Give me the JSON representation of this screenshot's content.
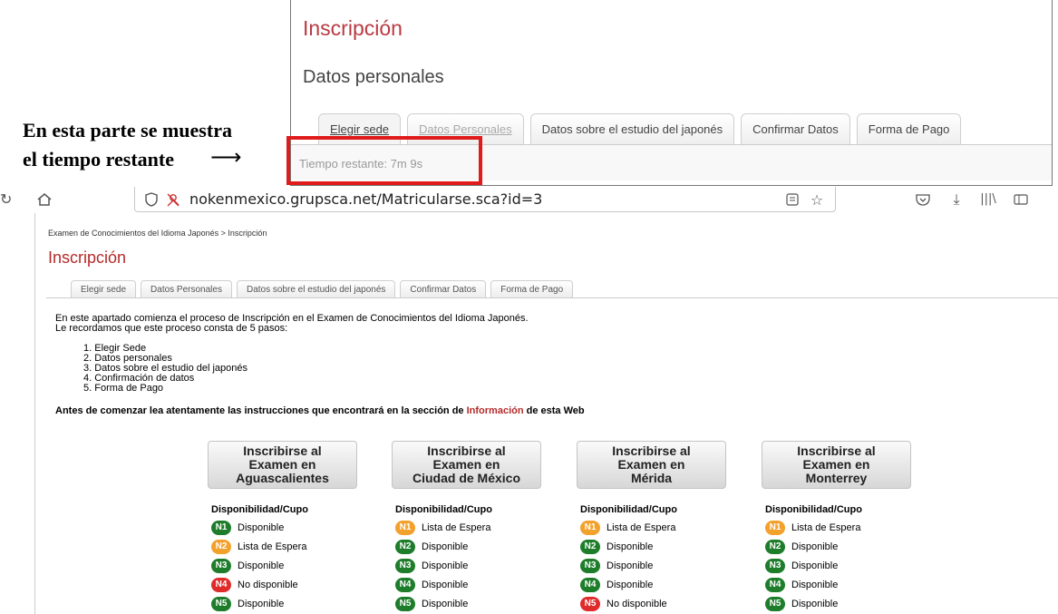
{
  "annotation": {
    "line1": "En esta parte se muestra",
    "line2": "el tiempo restante",
    "arrow": "⟶"
  },
  "inset": {
    "title": "Inscripción",
    "subtitle": "Datos personales",
    "tabs": [
      "Elegir sede",
      "Datos Personales",
      "Datos sobre el estudio del japonés",
      "Confirmar Datos",
      "Forma de Pago"
    ],
    "time_remaining": "Tiempo restante: 7m 9s"
  },
  "browser": {
    "url": "nokenmexico.grupsca.net/Matricularse.sca?id=3",
    "icons": [
      "reload-icon",
      "home-icon",
      "shield-icon",
      "blocked-permission-icon",
      "reader-mode-icon",
      "bookmark-star-icon",
      "pocket-icon",
      "download-icon",
      "library-icon",
      "sidebar-icon"
    ]
  },
  "page": {
    "breadcrumb": "Examen de Conocimientos del Idioma Japonés > Inscripción",
    "title": "Inscripción",
    "tabs": [
      "Elegir sede",
      "Datos Personales",
      "Datos sobre el estudio del japonés",
      "Confirmar Datos",
      "Forma de Pago"
    ],
    "intro_line1": "En este apartado comienza el proceso de Inscripción en el Examen de Conocimientos del Idioma Japonés.",
    "intro_line2": "Le recordamos que este proceso consta de 5 pasos:",
    "steps": [
      "1. Elegir Sede",
      "2. Datos personales",
      "3. Datos sobre el estudio del japonés",
      "4. Confirmación de datos",
      "5. Forma de Pago"
    ],
    "notice_before": "Antes de comenzar lea atentamente las instrucciones que encontrará en la sección de ",
    "notice_link": "Información",
    "notice_after": " de esta Web",
    "availability_label": "Disponibilidad/Cupo",
    "status_colors": {
      "Disponible": "#1e7d2b",
      "Lista de Espera": "#f2a12c",
      "No disponible": "#e02b2b"
    },
    "venues": [
      {
        "button_lines": [
          "Inscribirse al",
          "Examen en",
          "Aguascalientes"
        ],
        "levels": [
          {
            "code": "N1",
            "status": "Disponible"
          },
          {
            "code": "N2",
            "status": "Lista de Espera"
          },
          {
            "code": "N3",
            "status": "Disponible"
          },
          {
            "code": "N4",
            "status": "No disponible"
          },
          {
            "code": "N5",
            "status": "Disponible"
          }
        ]
      },
      {
        "button_lines": [
          "Inscribirse al",
          "Examen en",
          "Ciudad de México"
        ],
        "levels": [
          {
            "code": "N1",
            "status": "Lista de Espera"
          },
          {
            "code": "N2",
            "status": "Disponible"
          },
          {
            "code": "N3",
            "status": "Disponible"
          },
          {
            "code": "N4",
            "status": "Disponible"
          },
          {
            "code": "N5",
            "status": "Disponible"
          }
        ]
      },
      {
        "button_lines": [
          "Inscribirse al",
          "Examen en",
          "Mérida"
        ],
        "levels": [
          {
            "code": "N1",
            "status": "Lista de Espera"
          },
          {
            "code": "N2",
            "status": "Disponible"
          },
          {
            "code": "N3",
            "status": "Disponible"
          },
          {
            "code": "N4",
            "status": "Disponible"
          },
          {
            "code": "N5",
            "status": "No disponible"
          }
        ]
      },
      {
        "button_lines": [
          "Inscribirse al",
          "Examen en",
          "Monterrey"
        ],
        "levels": [
          {
            "code": "N1",
            "status": "Lista de Espera"
          },
          {
            "code": "N2",
            "status": "Disponible"
          },
          {
            "code": "N3",
            "status": "Disponible"
          },
          {
            "code": "N4",
            "status": "Disponible"
          },
          {
            "code": "N5",
            "status": "Disponible"
          }
        ]
      }
    ]
  }
}
